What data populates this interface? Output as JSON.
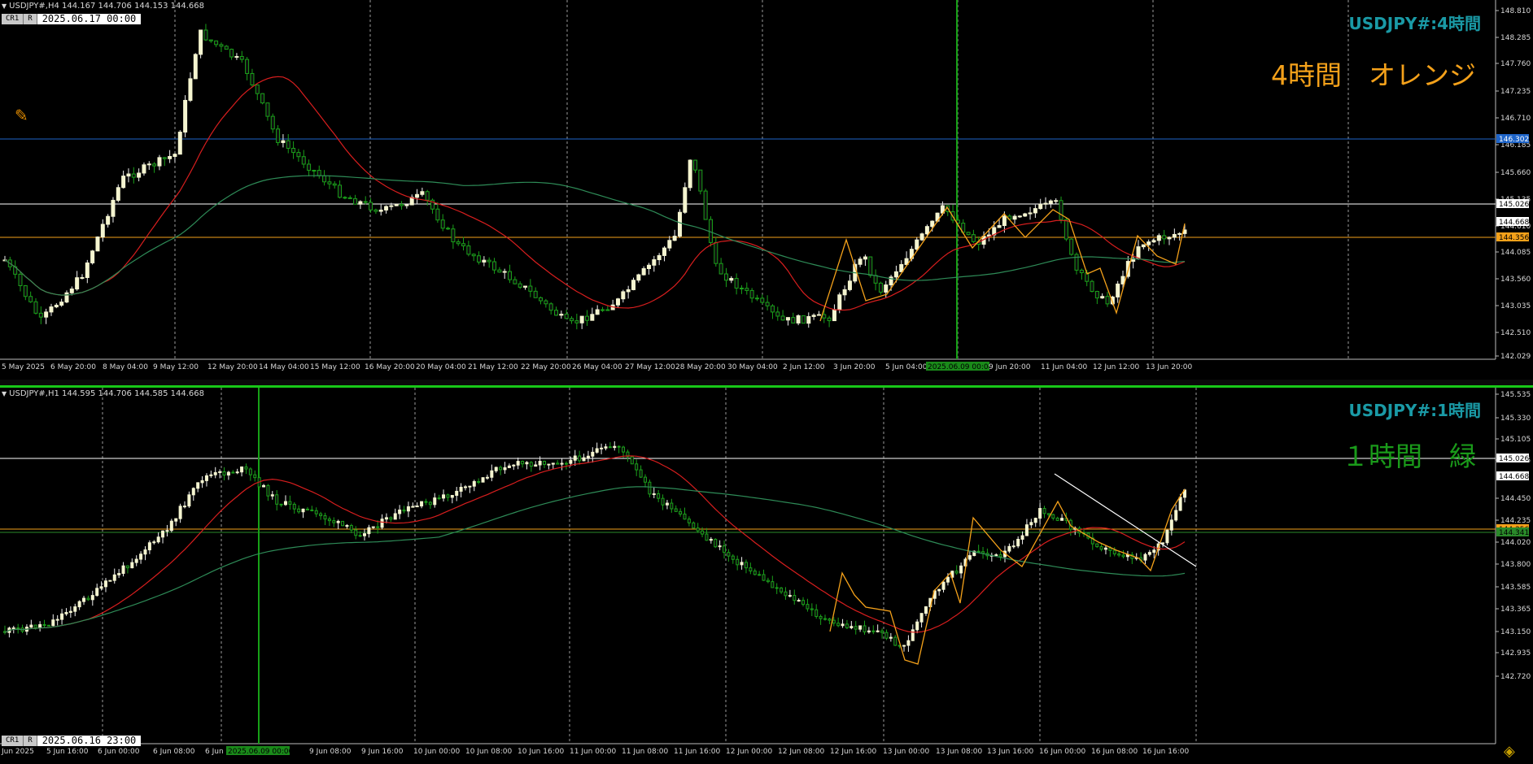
{
  "top_chart": {
    "info": "USDJPY#,H4  144.167 144.706 144.153 144.668",
    "btn_cr": "CR1",
    "btn_r": "R",
    "crosshair_time": "2025.06.17 00:00",
    "title": "USDJPY#:4時間",
    "note": "4時間　オレンジ",
    "note_color": "#f4a11a",
    "price_labels": [
      "148.810",
      "148.285",
      "147.760",
      "147.235",
      "146.710",
      "146.185",
      "145.660",
      "145.135",
      "144.610",
      "144.085",
      "143.560",
      "143.035",
      "142.510",
      "142.029"
    ],
    "marker_labels": [
      {
        "text": "146.302",
        "bg": "#1e64c8",
        "fg": "#fff"
      },
      {
        "text": "145.026",
        "bg": "#ffffff",
        "fg": "#000"
      },
      {
        "text": "144.668",
        "bg": "#ffffff",
        "fg": "#000"
      },
      {
        "text": "144.356",
        "bg": "#f4a11a",
        "fg": "#000"
      }
    ],
    "time_labels": [
      "5 May 2025",
      "6 May 20:00",
      "8 May 04:00",
      "9 May 12:00",
      "12 May 20:00",
      "14 May 04:00",
      "15 May 12:00",
      "16 May 20:00",
      "20 May 04:00",
      "21 May 12:00",
      "22 May 20:00",
      "26 May 04:00",
      "27 May 12:00",
      "28 May 20:00",
      "30 May 04:00",
      "2 Jun 12:00",
      "3 Jun 20:00",
      "5 Jun 04:00",
      "2025.06.09 00:00",
      "9 Jun 20:00",
      "11 Jun 04:00",
      "12 Jun 12:00",
      "13 Jun 20:00"
    ],
    "highlight_time": "2025.06.09 00:00"
  },
  "bottom_chart": {
    "info": "USDJPY#,H1  144.595 144.706 144.585 144.668",
    "btn_cr": "CR1",
    "btn_r": "R",
    "crosshair_time": "2025.06.16 23:00",
    "title": "USDJPY#:1時間",
    "note": "１時間　緑",
    "note_color": "#1a9a1a",
    "price_labels": [
      "145.535",
      "145.330",
      "145.105",
      "144.885",
      "144.450",
      "144.235",
      "144.020",
      "143.800",
      "143.585",
      "143.365",
      "143.150",
      "142.935",
      "142.720"
    ],
    "marker_labels": [
      {
        "text": "145.026",
        "bg": "#ffffff",
        "fg": "#000"
      },
      {
        "text": "144.668",
        "bg": "#ffffff",
        "fg": "#000"
      },
      {
        "text": "144.356",
        "bg": "#f4a11a",
        "fg": "#000"
      },
      {
        "text": "144.341",
        "bg": "#2a8a2a",
        "fg": "#000"
      }
    ],
    "time_labels": [
      "Jun 2025",
      "5 Jun 16:00",
      "6 Jun 00:00",
      "6 Jun 08:00",
      "6 Jun",
      "2025.06.09 00:00",
      "9 Jun 08:00",
      "9 Jun 16:00",
      "10 Jun 00:00",
      "10 Jun 08:00",
      "10 Jun 16:00",
      "11 Jun 00:00",
      "11 Jun 08:00",
      "11 Jun 16:00",
      "12 Jun 00:00",
      "12 Jun 08:00",
      "12 Jun 16:00",
      "13 Jun 00:00",
      "13 Jun 08:00",
      "13 Jun 16:00",
      "16 Jun 00:00",
      "16 Jun 08:00",
      "16 Jun 16:00"
    ],
    "highlight_time": "2025.06.09 00:00"
  },
  "icons": {
    "tool": "trendline-tool-icon",
    "logo": "platform-logo-icon"
  }
}
